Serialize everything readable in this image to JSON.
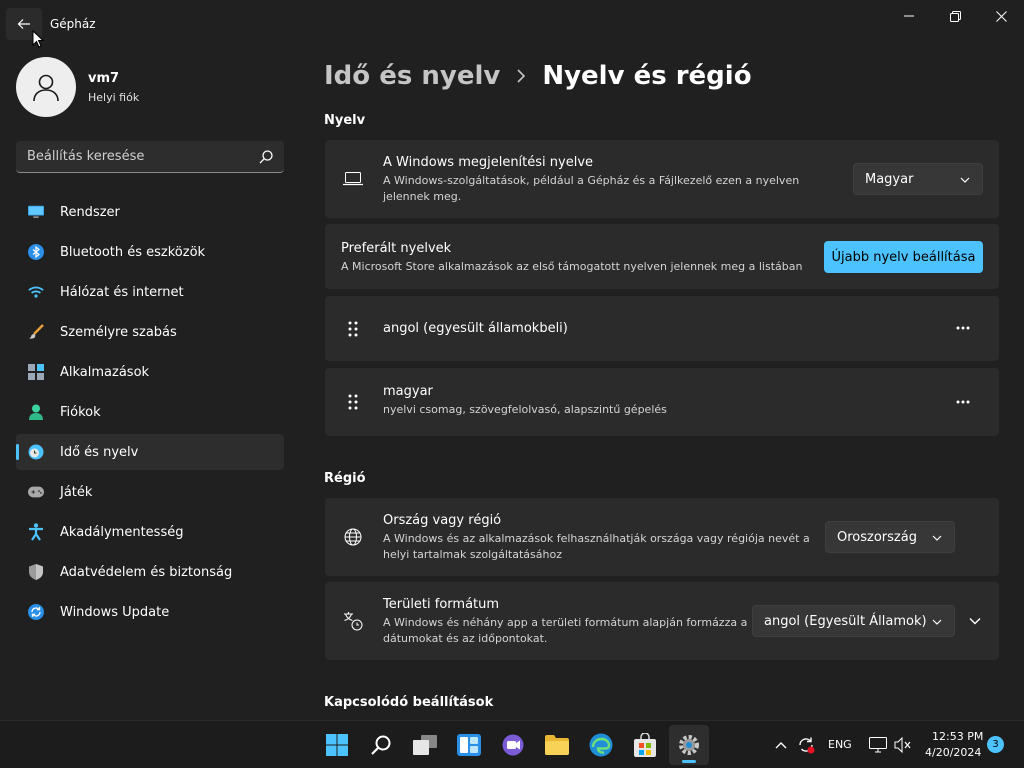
{
  "window": {
    "title": "Gépház"
  },
  "user": {
    "name": "vm7",
    "account_type": "Helyi fiók"
  },
  "search": {
    "placeholder": "Beállítás keresése"
  },
  "nav": {
    "items": [
      {
        "label": "Rendszer",
        "icon": "monitor-icon"
      },
      {
        "label": "Bluetooth és eszközök",
        "icon": "bluetooth-icon"
      },
      {
        "label": "Hálózat és internet",
        "icon": "wifi-icon"
      },
      {
        "label": "Személyre szabás",
        "icon": "brush-icon"
      },
      {
        "label": "Alkalmazások",
        "icon": "apps-icon"
      },
      {
        "label": "Fiókok",
        "icon": "person-icon"
      },
      {
        "label": "Idő és nyelv",
        "icon": "clock-globe-icon",
        "active": true
      },
      {
        "label": "Játék",
        "icon": "gamepad-icon"
      },
      {
        "label": "Akadálymentesség",
        "icon": "accessibility-icon"
      },
      {
        "label": "Adatvédelem és biztonság",
        "icon": "shield-icon"
      },
      {
        "label": "Windows Update",
        "icon": "update-icon"
      }
    ]
  },
  "breadcrumb": {
    "parent": "Idő és nyelv",
    "current": "Nyelv és régió"
  },
  "language_section": {
    "title": "Nyelv",
    "display_language": {
      "title": "A Windows megjelenítési nyelve",
      "description": "A Windows-szolgáltatások, például a Gépház és a Fájlkezelő ezen a nyelven jelennek meg.",
      "value": "Magyar"
    },
    "preferred": {
      "title": "Preferált nyelvek",
      "description": "A Microsoft Store alkalmazások az első támogatott nyelven jelennek meg a listában",
      "button": "Újabb nyelv beállítása"
    },
    "languages": [
      {
        "name": "angol (egyesült államokbeli)",
        "detail": ""
      },
      {
        "name": "magyar",
        "detail": "nyelvi csomag, szövegfelolvasó, alapszintű gépelés"
      }
    ]
  },
  "region_section": {
    "title": "Régió",
    "country": {
      "title": "Ország vagy régió",
      "description": "A Windows és az alkalmazások felhasználhatják országa vagy régiója nevét a helyi tartalmak szolgáltatásához",
      "value": "Oroszország"
    },
    "format": {
      "title": "Területi formátum",
      "description": "A Windows és néhány app a területi formátum alapján formázza a dátumokat és az időpontokat.",
      "value": "angol (Egyesült Államok)"
    }
  },
  "related_section": {
    "title": "Kapcsolódó beállítások"
  },
  "taskbar": {
    "language": "ENG",
    "time": "12:53 PM",
    "date": "4/20/2024",
    "notifications": "3"
  },
  "colors": {
    "accent": "#4cc2ff",
    "background": "#202020",
    "card": "#2b2b2b"
  }
}
